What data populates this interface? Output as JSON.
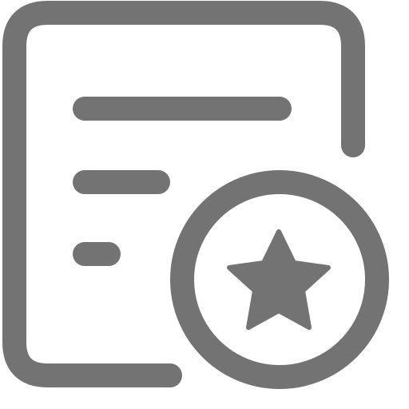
{
  "icon": {
    "name": "document-star-icon",
    "color": "#737373",
    "background": "#ffffff"
  }
}
